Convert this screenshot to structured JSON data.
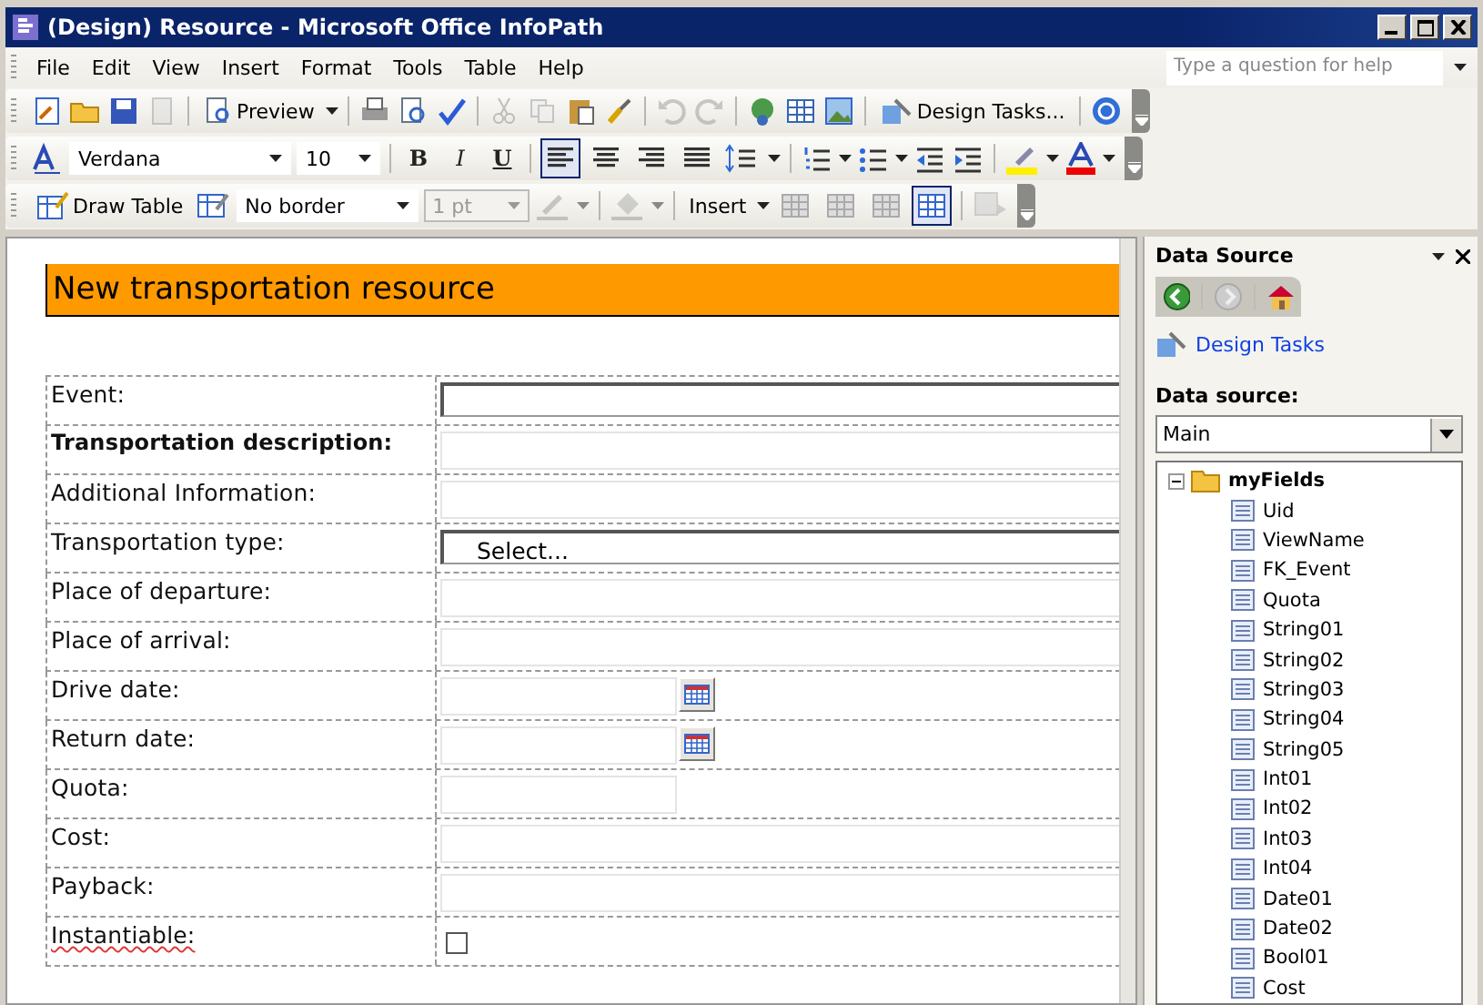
{
  "window": {
    "title": "(Design) Resource - Microsoft Office InfoPath"
  },
  "menu": [
    "File",
    "Edit",
    "View",
    "Insert",
    "Format",
    "Tools",
    "Table",
    "Help"
  ],
  "help_box": {
    "placeholder": "Type a question for help"
  },
  "standard_toolbar": {
    "preview": "Preview",
    "design_tasks": "Design Tasks..."
  },
  "formatting_toolbar": {
    "font": "Verdana",
    "size": "10",
    "bold": "B",
    "italic": "I",
    "underline": "U",
    "alignments": [
      {
        "selected": true
      },
      {
        "selected": false
      },
      {
        "selected": false
      },
      {
        "selected": false
      }
    ]
  },
  "table_toolbar": {
    "draw_table": "Draw Table",
    "border": "No border",
    "weight": {
      "value": "1 pt",
      "disabled": true
    },
    "insert": "Insert",
    "table_tools": [
      {
        "selected": false
      },
      {
        "selected": false
      },
      {
        "selected": false
      },
      {
        "selected": true
      }
    ]
  },
  "form": {
    "title": "New transportation resource",
    "rows": [
      {
        "label": "Event:",
        "bold": false,
        "kind": "dropdown",
        "spelling_error": false
      },
      {
        "label": "Transportation description:",
        "bold": true,
        "kind": "text",
        "spelling_error": false
      },
      {
        "label": "Additional Information:",
        "bold": false,
        "kind": "text",
        "spelling_error": false
      },
      {
        "label": "Transportation type:",
        "bold": false,
        "kind": "dropdown",
        "value": "Select...",
        "spelling_error": false
      },
      {
        "label": "Place of departure:",
        "bold": false,
        "kind": "text",
        "spelling_error": false
      },
      {
        "label": "Place of arrival:",
        "bold": false,
        "kind": "text",
        "spelling_error": false
      },
      {
        "label": "Drive date:",
        "bold": false,
        "kind": "date",
        "spelling_error": false
      },
      {
        "label": "Return date:",
        "bold": false,
        "kind": "date",
        "spelling_error": false
      },
      {
        "label": "Quota:",
        "bold": false,
        "kind": "short_text",
        "spelling_error": false
      },
      {
        "label": "Cost:",
        "bold": false,
        "kind": "text",
        "spelling_error": false
      },
      {
        "label": "Payback:",
        "bold": false,
        "kind": "text",
        "spelling_error": false
      },
      {
        "label": "Instantiable:",
        "bold": false,
        "kind": "checkbox",
        "checked": false,
        "spelling_error": true
      }
    ]
  },
  "task_pane": {
    "title": "Data Source",
    "link": "Design Tasks",
    "source_label": "Data source:",
    "source": "Main",
    "tree": {
      "name": "myFields",
      "expanded": true,
      "children": [
        {
          "name": "Uid"
        },
        {
          "name": "ViewName"
        },
        {
          "name": "FK_Event"
        },
        {
          "name": "Quota"
        },
        {
          "name": "String01"
        },
        {
          "name": "String02"
        },
        {
          "name": "String03"
        },
        {
          "name": "String04"
        },
        {
          "name": "String05"
        },
        {
          "name": "Int01"
        },
        {
          "name": "Int02"
        },
        {
          "name": "Int03"
        },
        {
          "name": "Int04"
        },
        {
          "name": "Date01"
        },
        {
          "name": "Date02"
        },
        {
          "name": "Bool01"
        },
        {
          "name": "Cost"
        }
      ]
    }
  }
}
